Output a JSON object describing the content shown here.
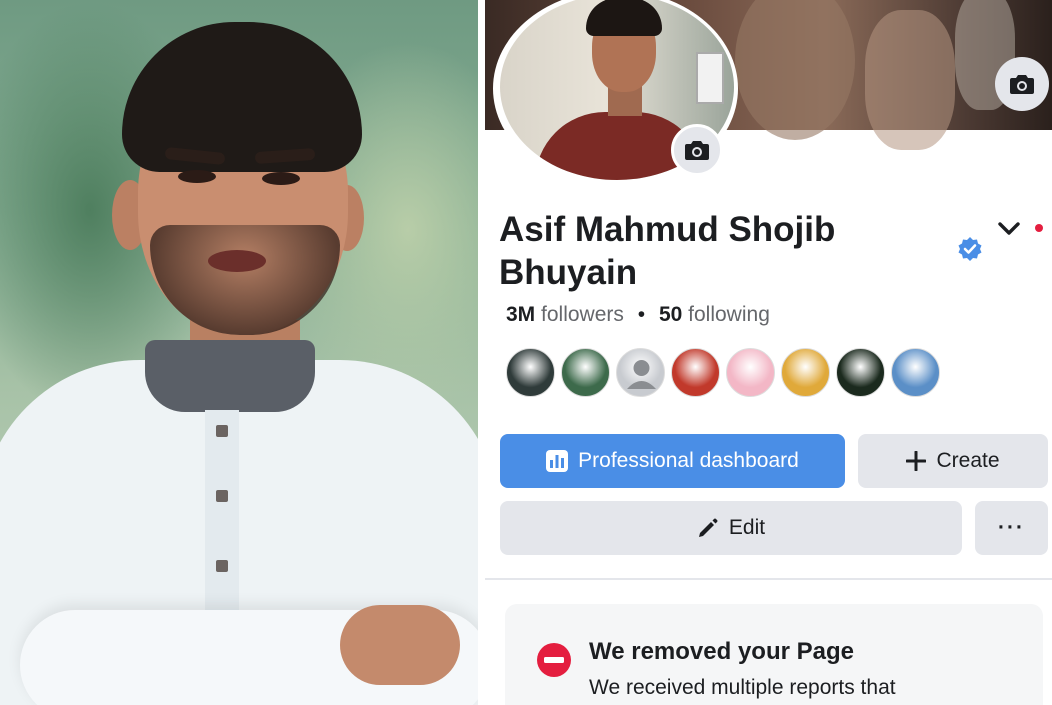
{
  "profile": {
    "name": "Asif Mahmud Shojib Bhuyain",
    "followers_count": "3M",
    "followers_label": "followers",
    "separator": "•",
    "following_count": "50",
    "following_label": "following"
  },
  "friends": [
    {
      "name": "friend-1",
      "color": "#2f3b3a"
    },
    {
      "name": "friend-2",
      "color": "#3d6a4b"
    },
    {
      "name": "friend-3",
      "color": "#c8cbd0"
    },
    {
      "name": "friend-4",
      "color": "#c1392b"
    },
    {
      "name": "friend-5",
      "color": "#f3b7c6"
    },
    {
      "name": "friend-6",
      "color": "#e0a93a"
    },
    {
      "name": "friend-7",
      "color": "#1b2a1e"
    },
    {
      "name": "friend-8",
      "color": "#5b8fc7"
    }
  ],
  "actions": {
    "professional_dashboard": "Professional dashboard",
    "create": "Create",
    "edit": "Edit",
    "more": "···"
  },
  "notice": {
    "title": "We removed your Page",
    "body": "We received multiple reports that"
  },
  "colors": {
    "primary_blue": "#4a8ee6",
    "verified_blue": "#4a8ee6",
    "button_gray": "#e4e6eb",
    "error_red": "#e41e3f"
  },
  "icons": {
    "cover_camera": "camera-icon",
    "avatar_camera": "camera-icon",
    "verified": "verified-badge-icon",
    "menu": "chevron-down-icon",
    "dashboard": "bar-chart-icon",
    "create": "plus-icon",
    "edit": "pencil-icon",
    "notice": "no-entry-icon"
  }
}
